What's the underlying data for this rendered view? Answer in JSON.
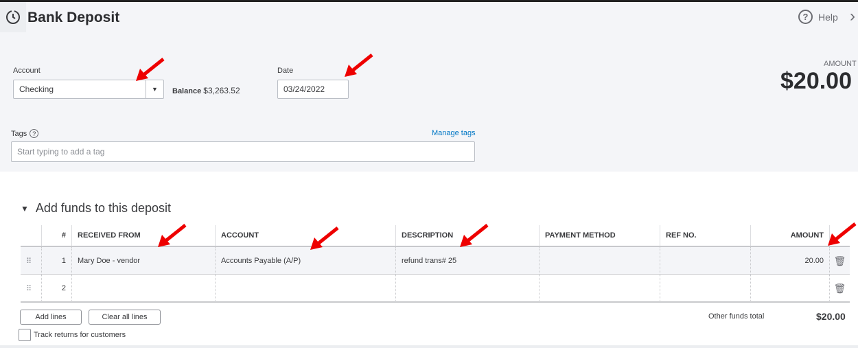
{
  "header": {
    "title": "Bank Deposit",
    "help_label": "Help"
  },
  "account": {
    "label": "Account",
    "value": "Checking",
    "balance_label": "Balance",
    "balance_value": "$3,263.52"
  },
  "date": {
    "label": "Date",
    "value": "03/24/2022"
  },
  "amount": {
    "label": "AMOUNT",
    "value": "$20.00"
  },
  "tags": {
    "label": "Tags",
    "manage_link": "Manage tags",
    "placeholder": "Start typing to add a tag"
  },
  "section": {
    "title": "Add funds to this deposit"
  },
  "table": {
    "columns": [
      "#",
      "RECEIVED FROM",
      "ACCOUNT",
      "DESCRIPTION",
      "PAYMENT METHOD",
      "REF NO.",
      "AMOUNT"
    ],
    "rows": [
      {
        "num": "1",
        "received_from": "Mary Doe - vendor",
        "account": "Accounts Payable (A/P)",
        "description": "refund trans# 25",
        "payment_method": "",
        "ref_no": "",
        "amount": "20.00"
      },
      {
        "num": "2",
        "received_from": "",
        "account": "",
        "description": "",
        "payment_method": "",
        "ref_no": "",
        "amount": ""
      }
    ]
  },
  "footer": {
    "add_lines": "Add lines",
    "clear_lines": "Clear all lines",
    "track_returns": "Track returns for customers",
    "total_label": "Other funds total",
    "total_value": "$20.00"
  }
}
